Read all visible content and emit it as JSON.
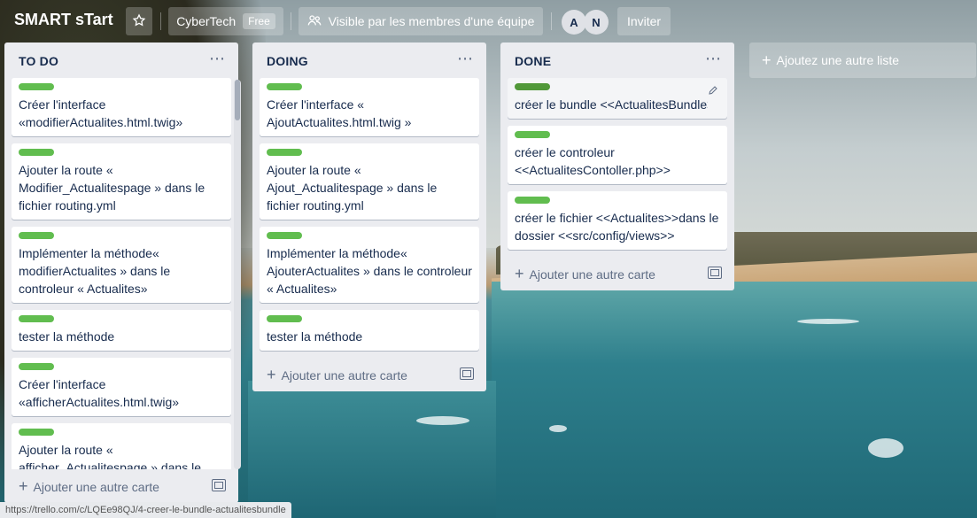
{
  "header": {
    "board_title": "SMART sTart",
    "team_name": "CyberTech",
    "team_badge": "Free",
    "visibility_label": "Visible par les membres d'une équipe",
    "members": [
      "A",
      "N"
    ],
    "invite_label": "Inviter"
  },
  "lists": [
    {
      "title": "TO DO",
      "cards": [
        {
          "text": "Créer l'interface «modifierActualites.html.twig»"
        },
        {
          "text": "Ajouter la route « Modifier_Actualitespage » dans le fichier routing.yml"
        },
        {
          "text": "Implémenter la méthode« modifierActualites » dans le controleur « Actualites»"
        },
        {
          "text": "tester la méthode"
        },
        {
          "text": "Créer l'interface «afficherActualites.html.twig»"
        },
        {
          "text": "Ajouter la route « afficher_Actualitespage » dans le"
        }
      ],
      "add_card_label": "Ajouter une autre carte"
    },
    {
      "title": "DOING",
      "cards": [
        {
          "text": "Créer l'interface « AjoutActualites.html.twig »"
        },
        {
          "text": "Ajouter la route « Ajout_Actualitespage » dans le fichier routing.yml"
        },
        {
          "text": "Implémenter la méthode« AjouterActualites » dans le controleur « Actualites»"
        },
        {
          "text": "tester la méthode"
        }
      ],
      "add_card_label": "Ajouter une autre carte"
    },
    {
      "title": "DONE",
      "cards": [
        {
          "text": "créer le bundle <<ActualitesBundle>>"
        },
        {
          "text": "créer le controleur <<ActualitesContoller.php>>"
        },
        {
          "text": "créer le fichier <<Actualites>>dans le dossier <<src/config/views>>"
        }
      ],
      "add_card_label": "Ajouter une autre carte"
    }
  ],
  "add_list_label": "Ajoutez une autre liste",
  "status_url": "https://trello.com/c/LQEe98QJ/4-creer-le-bundle-actualitesbundle",
  "colors": {
    "label_green": "#61bd4f",
    "label_green_dark": "#519839",
    "list_bg": "#ebecf0"
  }
}
